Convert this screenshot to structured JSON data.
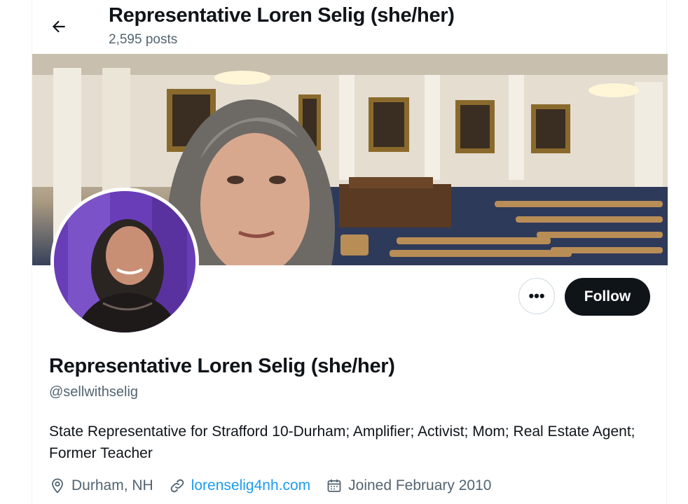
{
  "header": {
    "back_icon": "arrow-left-icon",
    "title": "Representative Loren Selig (she/her)",
    "posts_count": "2,595 posts"
  },
  "profile": {
    "banner_alt": "Selfie in legislative chamber",
    "avatar_alt": "Profile photo",
    "more_label": "•••",
    "follow_label": "Follow",
    "name": "Representative Loren Selig (she/her)",
    "handle": "@sellwithselig",
    "bio": "State Representative for Strafford 10-Durham; Amplifier; Activist; Mom; Real Estate Agent; Former Teacher",
    "location": "Durham, NH",
    "website": "lorenselig4nh.com",
    "joined": "Joined February 2010"
  },
  "colors": {
    "link": "#1d9bf0",
    "secondary_text": "#536471",
    "button_dark": "#0f1419"
  }
}
